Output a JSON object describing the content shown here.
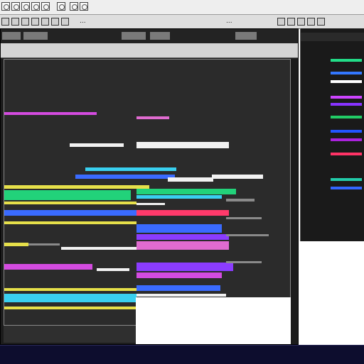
{
  "toolbar": {
    "buttons": [
      "open-icon",
      "save-icon",
      "cut-icon",
      "copy-icon",
      "paste-icon",
      "undo-icon",
      "redo-icon",
      "render-icon"
    ]
  },
  "strip": {
    "left_label": "...",
    "right_label": "..."
  },
  "menu": {
    "items": [
      "",
      "",
      "",
      "",
      ""
    ]
  },
  "window": {
    "title": ""
  },
  "status": {
    "text": ""
  },
  "side_panel": {
    "title": "",
    "rows": [
      {
        "label": "",
        "color": "#22dd88"
      },
      {
        "label": "",
        "color": "#3377ff"
      },
      {
        "label": "",
        "color": "#ffffff"
      },
      {
        "label": "",
        "color": "#cc44ff"
      },
      {
        "label": "",
        "color": "#8833ff"
      },
      {
        "label": "",
        "color": "#22cc66"
      },
      {
        "label": "",
        "color": "#2255ff"
      },
      {
        "label": "",
        "color": "#aa22dd"
      },
      {
        "label": "",
        "color": "#ff3366"
      },
      {
        "label": "",
        "color": "#22ccaa"
      },
      {
        "label": "",
        "color": "#3366ff"
      }
    ]
  },
  "canvas": {
    "colors": {
      "magenta": "#d44be0",
      "pink": "#e06bd0",
      "white": "#f2f2f2",
      "cyan": "#39d0f0",
      "blue": "#3a6bff",
      "green": "#22d27a",
      "yellow": "#e6e04a",
      "grey": "#8a8a8a",
      "purple": "#8b3cff",
      "red": "#ff3a6b"
    }
  }
}
